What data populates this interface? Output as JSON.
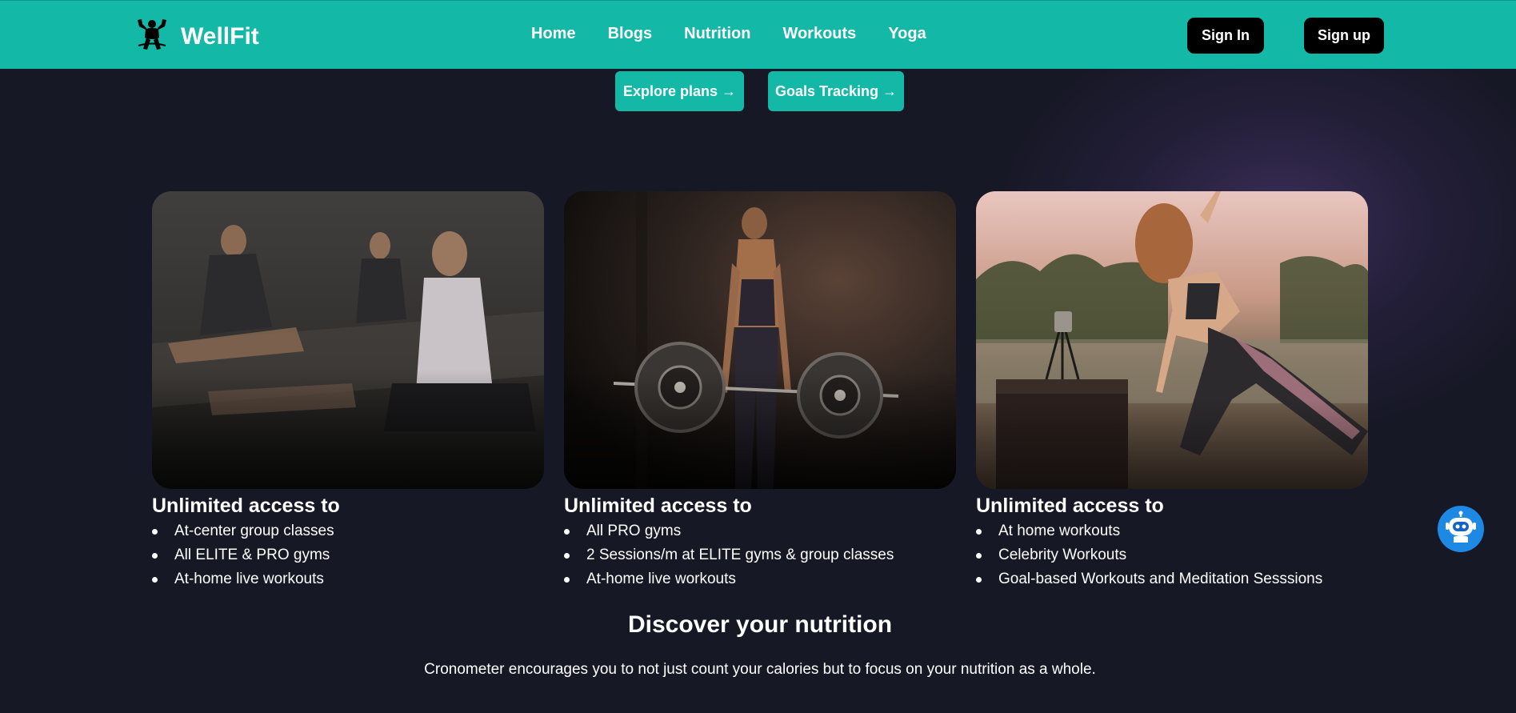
{
  "brand": {
    "name": "WellFit",
    "logo_icon": "bodybuilder-icon"
  },
  "nav": {
    "links": [
      "Home",
      "Blogs",
      "Nutrition",
      "Workouts",
      "Yoga"
    ],
    "sign_in": "Sign In",
    "sign_up": "Sign up"
  },
  "cta": {
    "explore": "Explore plans →",
    "goals": "Goals Tracking →"
  },
  "cards": [
    {
      "image": "group-yoga-class-photo",
      "title": "Unlimited access to",
      "items": [
        "At-center group classes",
        "All ELITE & PRO gyms",
        "At-home live workouts"
      ]
    },
    {
      "image": "deadlift-barbell-photo",
      "title": "Unlimited access to",
      "items": [
        "All PRO gyms",
        "2 Sessions/m at ELITE gyms & group classes",
        "At-home live workouts"
      ]
    },
    {
      "image": "outdoor-home-workout-photo",
      "title": "Unlimited access to",
      "items": [
        "At home workouts",
        "Celebrity Workouts",
        "Goal-based Workouts and Meditation Sesssions"
      ]
    }
  ],
  "nutrition": {
    "title": "Discover your nutrition",
    "text": "Cronometer encourages you to not just count your calories but to focus on your nutrition as a whole."
  },
  "chatbot": {
    "icon": "robot-icon"
  },
  "colors": {
    "primary": "#14b8a6",
    "background": "#171826",
    "button_dark": "#000000",
    "chatbot": "#1e88e5"
  }
}
